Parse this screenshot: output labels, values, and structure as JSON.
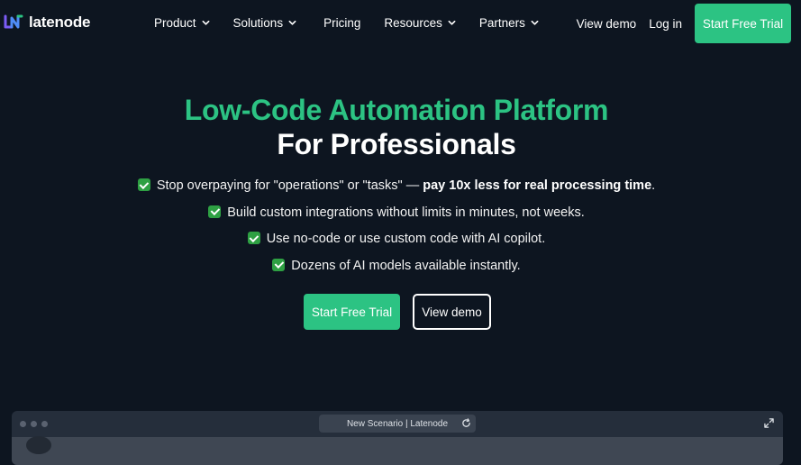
{
  "brand": {
    "name": "latenode"
  },
  "nav": {
    "items": [
      {
        "label": "Product",
        "dropdown": true
      },
      {
        "label": "Solutions",
        "dropdown": true
      },
      {
        "label": "Pricing",
        "dropdown": false
      },
      {
        "label": "Resources",
        "dropdown": true
      },
      {
        "label": "Partners",
        "dropdown": true
      }
    ],
    "view_demo": "View demo",
    "login": "Log in",
    "cta": "Start Free Trial"
  },
  "hero": {
    "title_line1": "Low-Code Automation Platform",
    "title_line2": "For Professionals",
    "bullets": [
      {
        "text": "Stop overpaying for \"operations\" or \"tasks\" — ",
        "bold": "pay 10x less for real processing time",
        "tail": "."
      },
      {
        "text": "Build custom integrations without limits in minutes, not weeks.",
        "bold": "",
        "tail": ""
      },
      {
        "text": "Use no-code or use custom code with AI copilot.",
        "bold": "",
        "tail": ""
      },
      {
        "text": "Dozens of AI models available instantly.",
        "bold": "",
        "tail": ""
      }
    ],
    "cta_primary": "Start Free Trial",
    "cta_secondary": "View demo"
  },
  "preview": {
    "url_text": "New Scenario | Latenode"
  },
  "colors": {
    "background": "#0d1520",
    "accent": "#2cc383",
    "check": "#2ea043"
  },
  "icons": [
    "logo-mark-icon",
    "chevron-down-icon",
    "check-icon",
    "reload-icon",
    "expand-icon"
  ]
}
